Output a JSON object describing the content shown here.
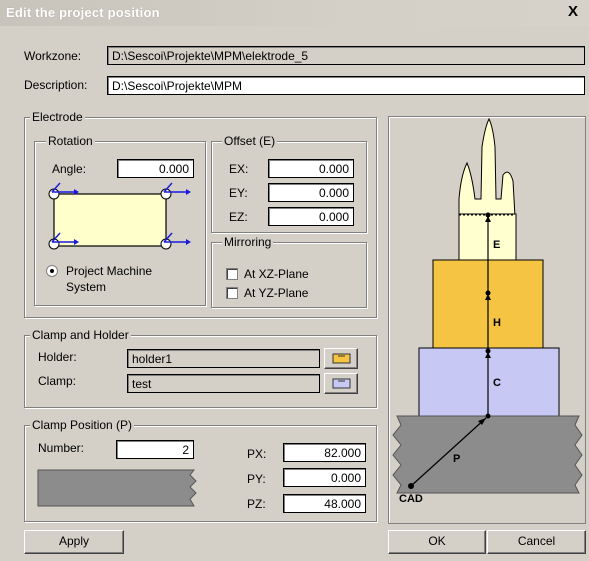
{
  "window": {
    "title": "Edit the project position",
    "close_glyph": "X"
  },
  "workzone": {
    "label": "Workzone:",
    "value": "D:\\Sescoi\\Projekte\\MPM\\elektrode_5"
  },
  "description": {
    "label": "Description:",
    "value": "D:\\Sescoi\\Projekte\\MPM"
  },
  "electrode": {
    "title": "Electrode",
    "rotation": {
      "title": "Rotation",
      "angle_label": "Angle:",
      "angle_value": "0.000",
      "radio_label_line1": "Project Machine",
      "radio_label_line2": "System"
    },
    "offset": {
      "title": "Offset (E)",
      "ex_label": "EX:",
      "ex_value": "0.000",
      "ey_label": "EY:",
      "ey_value": "0.000",
      "ez_label": "EZ:",
      "ez_value": "0.000"
    },
    "mirroring": {
      "title": "Mirroring",
      "xz_label": "At XZ-Plane",
      "yz_label": "At YZ-Plane"
    }
  },
  "clamp_holder": {
    "title": "Clamp and Holder",
    "holder_label": "Holder:",
    "holder_value": "holder1",
    "holder_icon": "yellow-holder-icon",
    "clamp_label": "Clamp:",
    "clamp_value": "test",
    "clamp_icon": "blue-clamp-icon"
  },
  "clamp_position": {
    "title": "Clamp Position (P)",
    "number_label": "Number:",
    "number_value": "2",
    "px_label": "PX:",
    "px_value": "82.000",
    "py_label": "PY:",
    "py_value": "0.000",
    "pz_label": "PZ:",
    "pz_value": "48.000"
  },
  "diagram": {
    "label_e": "E",
    "label_h": "H",
    "label_c": "C",
    "label_p": "P",
    "label_cad": "CAD",
    "colors": {
      "electrode": "#ffffd0",
      "holder": "#f5c442",
      "clamp": "#c8c8f5",
      "base": "#8c8c8c"
    }
  },
  "buttons": {
    "apply": "Apply",
    "ok": "OK",
    "cancel": "Cancel"
  }
}
